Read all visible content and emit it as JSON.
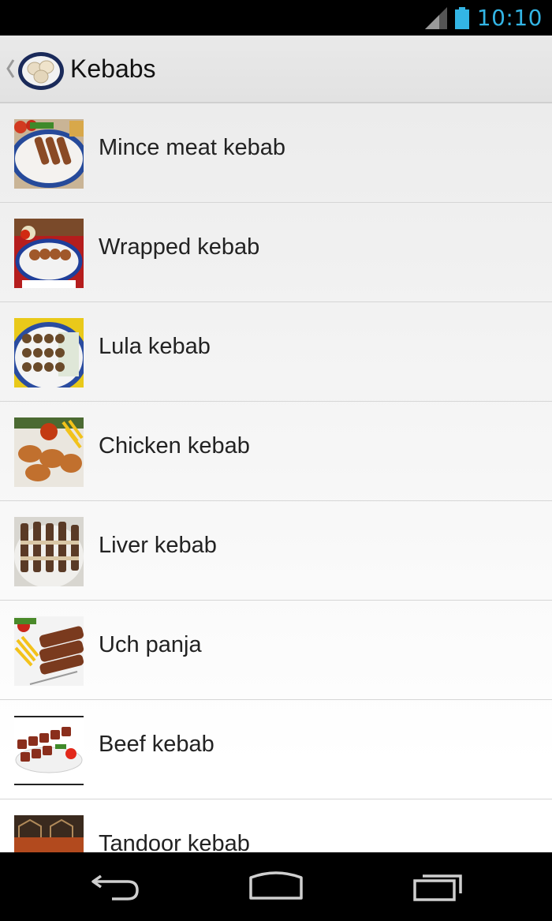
{
  "status_bar": {
    "time": "10:10",
    "signal_icon": "signal-icon",
    "battery_icon": "battery-icon",
    "accent": "#33b5e5"
  },
  "action_bar": {
    "title": "Kebabs",
    "up_icon": "chevron-left-icon",
    "app_icon": "dumplings-plate-icon"
  },
  "list": {
    "items": [
      {
        "label": "Mince meat kebab"
      },
      {
        "label": "Wrapped kebab"
      },
      {
        "label": "Lula kebab"
      },
      {
        "label": "Chicken kebab"
      },
      {
        "label": "Liver kebab"
      },
      {
        "label": "Uch panja"
      },
      {
        "label": "Beef kebab"
      },
      {
        "label": "Tandoor kebab"
      }
    ]
  },
  "nav_bar": {
    "back_icon": "back-icon",
    "home_icon": "home-icon",
    "recents_icon": "recents-icon"
  }
}
